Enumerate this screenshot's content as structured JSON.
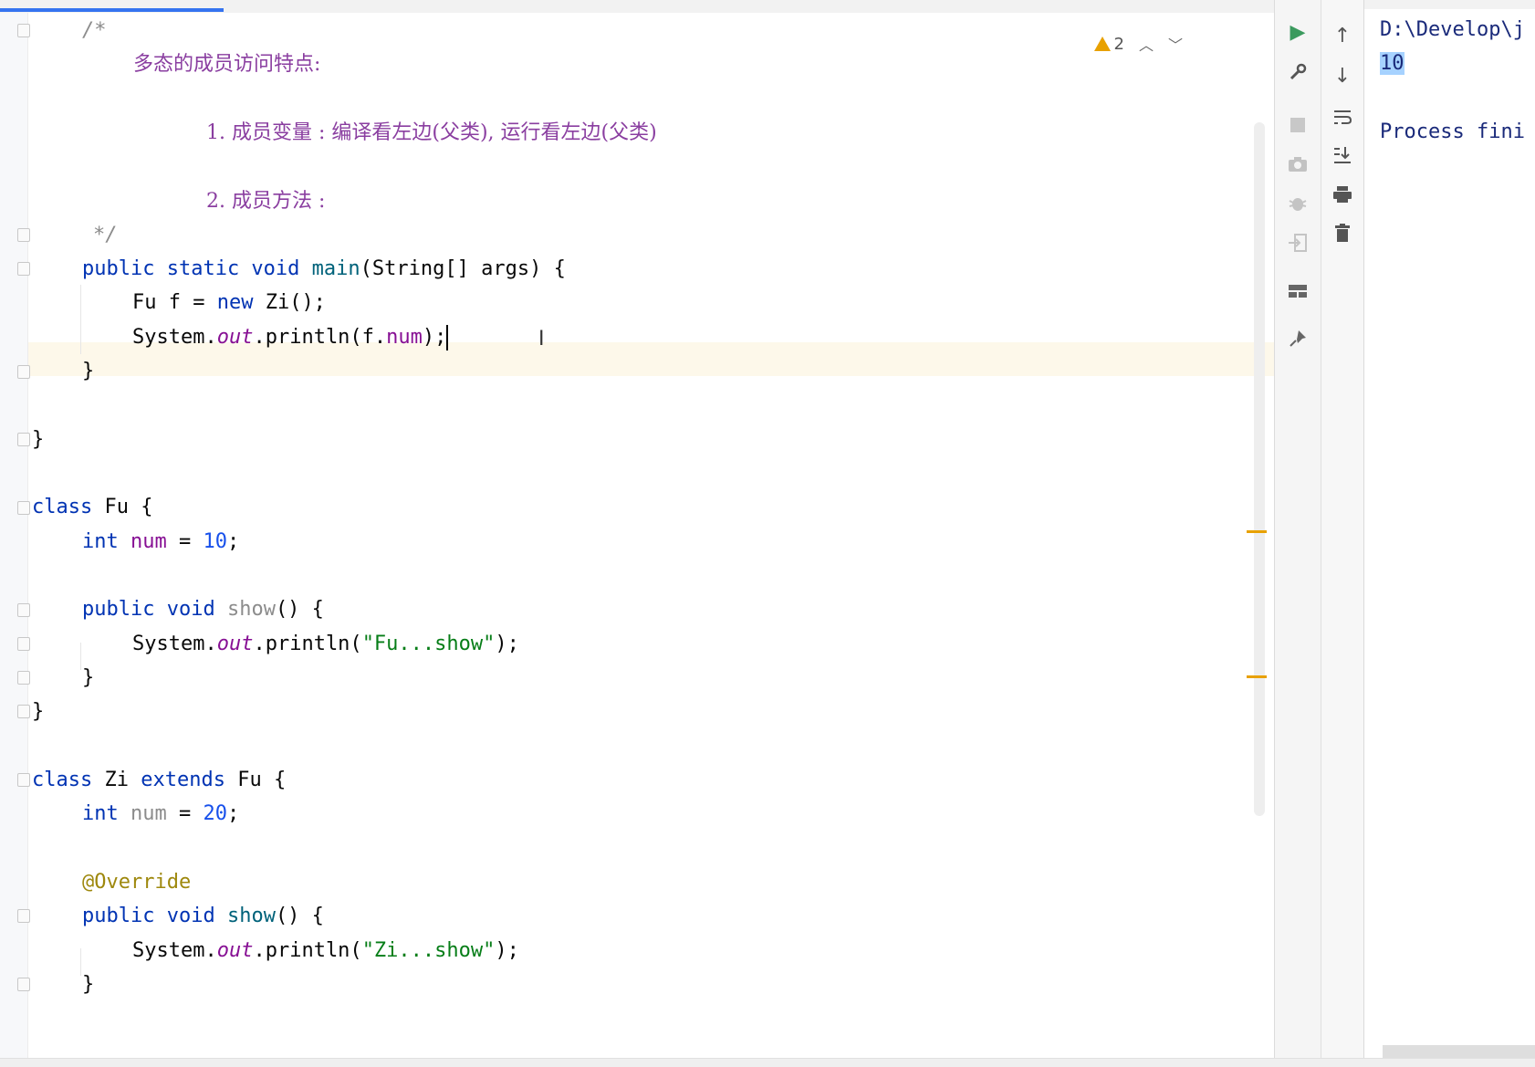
{
  "editor": {
    "inspection_count": "2",
    "lines": [
      "/*",
      "多态的成员访问特点:",
      "1. 成员变量 : 编译看左边(父类), 运行看左边(父类)",
      "2. 成员方法 :",
      "*/",
      "public static void main(String[] args) {",
      "Fu f = new Zi();",
      "System.out.println(f.num);",
      "}",
      "}",
      "class Fu {",
      "int num = 10;",
      "public void show() {",
      "System.out.println(\"Fu...show\");",
      "}",
      "}",
      "class Zi extends Fu {",
      "int num = 20;",
      "@Override",
      "public void show() {",
      "System.out.println(\"Zi...show\");",
      "}"
    ]
  },
  "console": {
    "path_line": "D:\\Develop\\j",
    "output_value": "10",
    "process_line": "Process fini"
  },
  "icons": {
    "run": "play-icon",
    "settings": "wrench-icon",
    "stop": "stop-icon",
    "camera": "camera-icon",
    "debug": "bug-icon",
    "login": "enter-icon",
    "layout": "layout-icon",
    "pin": "pin-icon",
    "up": "arrow-up-icon",
    "down": "arrow-down-icon",
    "wrap": "soft-wrap-icon",
    "scroll_end": "scroll-to-end-icon",
    "print": "print-icon",
    "delete": "trash-icon"
  },
  "colors": {
    "keyword": "#0033b3",
    "string": "#067d17",
    "number": "#1750eb",
    "annotation": "#9e880d",
    "warning": "#e8a100"
  }
}
